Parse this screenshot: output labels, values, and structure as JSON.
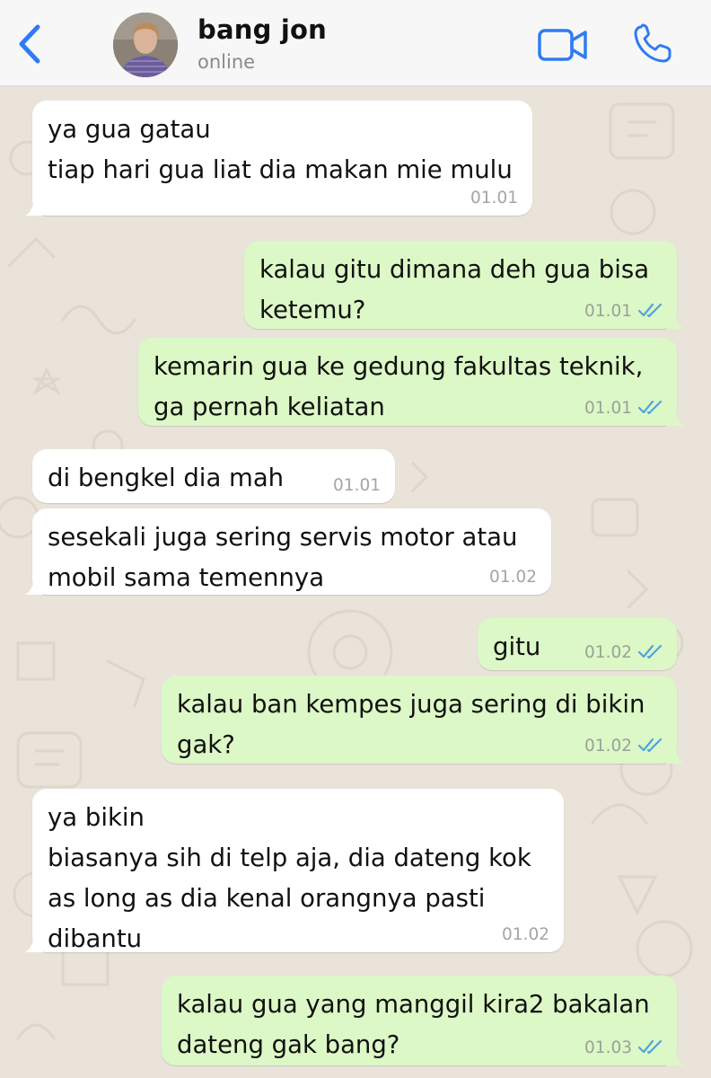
{
  "header": {
    "back_icon": "chevron-left-icon",
    "contact_name": "bang jon",
    "status": "online",
    "video_icon": "video-call-icon",
    "call_icon": "phone-icon"
  },
  "colors": {
    "accent": "#2f7bf5",
    "incoming_bubble": "#ffffff",
    "outgoing_bubble": "#dcf8c6",
    "chat_background": "#e9e3da",
    "read_ticks": "#4fa3e0"
  },
  "messages": [
    {
      "direction": "incoming",
      "text": "ya gua gatau\ntiap hari gua liat dia makan mie mulu",
      "time": "01.01"
    },
    {
      "direction": "outgoing",
      "text": "kalau gitu dimana deh gua bisa\nketemu?",
      "time": "01.01",
      "status": "read"
    },
    {
      "direction": "outgoing",
      "text": "kemarin gua ke gedung fakultas teknik,\nga pernah keliatan",
      "time": "01.01",
      "status": "read"
    },
    {
      "direction": "incoming",
      "text": "di bengkel dia mah",
      "time": "01.01"
    },
    {
      "direction": "incoming",
      "text": "sesekali juga sering servis motor atau\nmobil sama temennya",
      "time": "01.02"
    },
    {
      "direction": "outgoing",
      "text": "gitu",
      "time": "01.02",
      "status": "read"
    },
    {
      "direction": "outgoing",
      "text": "kalau ban kempes juga sering di bikin\ngak?",
      "time": "01.02",
      "status": "read"
    },
    {
      "direction": "incoming",
      "text": "ya bikin\nbiasanya sih di telp aja, dia dateng kok\nas long as dia kenal orangnya pasti\ndibantu",
      "time": "01.02"
    },
    {
      "direction": "outgoing",
      "text": "kalau gua yang manggil kira2 bakalan\ndateng gak bang?",
      "time": "01.03",
      "status": "read"
    }
  ]
}
